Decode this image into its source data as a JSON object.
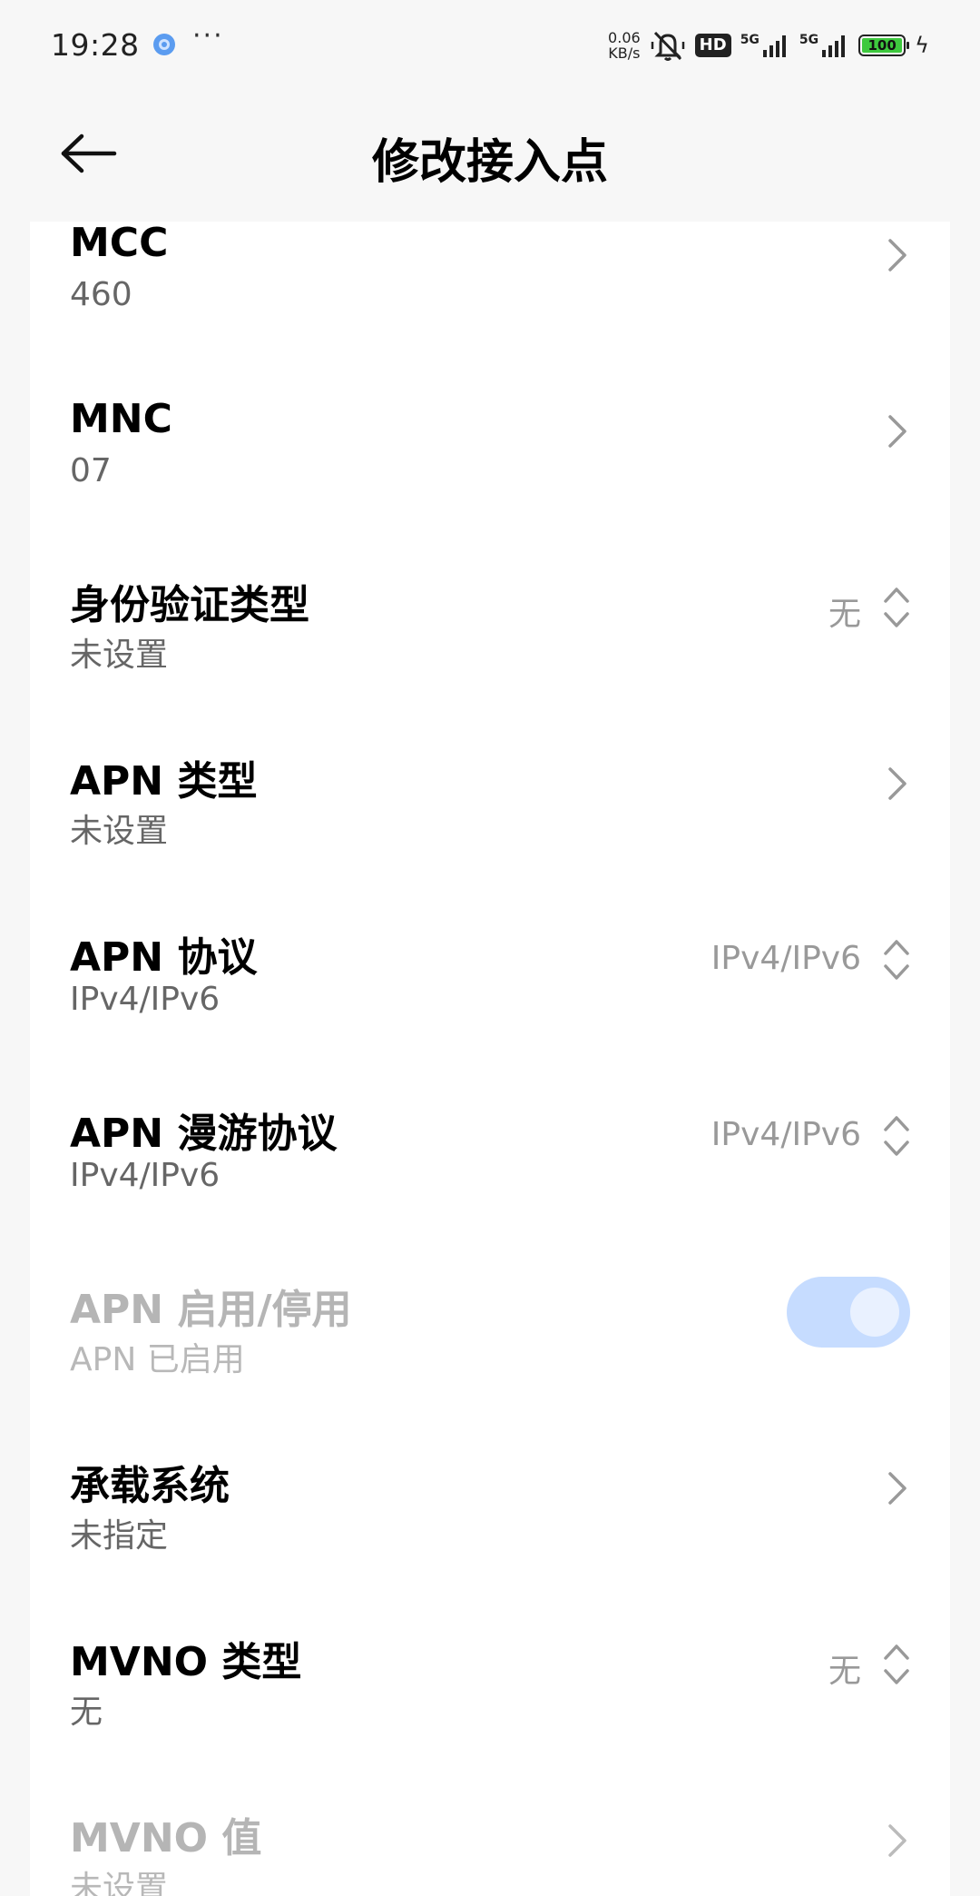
{
  "status_bar": {
    "time": "19:28",
    "more": "···",
    "speed_value": "0.06",
    "speed_unit": "KB/s",
    "hd": "HD",
    "net1": "5G",
    "net2": "5G",
    "battery": "100"
  },
  "header": {
    "title": "修改接入点"
  },
  "settings": [
    {
      "title": "MCC",
      "subtitle": "460",
      "value": "",
      "control": "chevron",
      "enabled": true
    },
    {
      "title": "MNC",
      "subtitle": "07",
      "value": "",
      "control": "chevron",
      "enabled": true
    },
    {
      "title": "身份验证类型",
      "subtitle": "未设置",
      "value": "无",
      "control": "dropdown",
      "enabled": true
    },
    {
      "title": "APN 类型",
      "subtitle": "未设置",
      "value": "",
      "control": "chevron",
      "enabled": true
    },
    {
      "title": "APN 协议",
      "subtitle": "IPv4/IPv6",
      "value": "IPv4/IPv6",
      "control": "dropdown",
      "enabled": true
    },
    {
      "title": "APN 漫游协议",
      "subtitle": "IPv4/IPv6",
      "value": "IPv4/IPv6",
      "control": "dropdown",
      "enabled": true
    },
    {
      "title": "APN 启用/停用",
      "subtitle": "APN 已启用",
      "value": "",
      "control": "toggle",
      "enabled": false,
      "toggle_on": true
    },
    {
      "title": "承载系统",
      "subtitle": "未指定",
      "value": "",
      "control": "chevron",
      "enabled": true
    },
    {
      "title": "MVNO 类型",
      "subtitle": "无",
      "value": "无",
      "control": "dropdown",
      "enabled": true
    },
    {
      "title": "MVNO 值",
      "subtitle": "未设置",
      "value": "",
      "control": "chevron",
      "enabled": false
    }
  ],
  "colors": {
    "background": "#f7f7f7",
    "card": "#ffffff",
    "toggle_track": "#c6dcff",
    "battery_fill": "#3ec93e"
  }
}
